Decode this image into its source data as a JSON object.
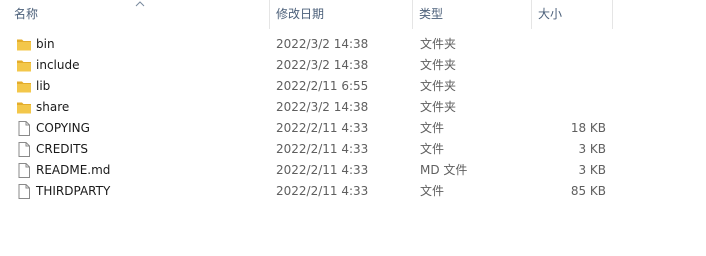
{
  "columns": {
    "name": "名称",
    "date": "修改日期",
    "type": "类型",
    "size": "大小"
  },
  "colors": {
    "folder": "#f3c74a",
    "folder_tab": "#e4ad2b",
    "header_text": "#4c607a"
  },
  "rows": [
    {
      "name": "bin",
      "date": "2022/3/2 14:38",
      "type": "文件夹",
      "size": "",
      "icon": "folder-icon"
    },
    {
      "name": "include",
      "date": "2022/3/2 14:38",
      "type": "文件夹",
      "size": "",
      "icon": "folder-icon"
    },
    {
      "name": "lib",
      "date": "2022/2/11 6:55",
      "type": "文件夹",
      "size": "",
      "icon": "folder-icon"
    },
    {
      "name": "share",
      "date": "2022/3/2 14:38",
      "type": "文件夹",
      "size": "",
      "icon": "folder-icon"
    },
    {
      "name": "COPYING",
      "date": "2022/2/11 4:33",
      "type": "文件",
      "size": "18 KB",
      "icon": "file-icon"
    },
    {
      "name": "CREDITS",
      "date": "2022/2/11 4:33",
      "type": "文件",
      "size": "3 KB",
      "icon": "file-icon"
    },
    {
      "name": "README.md",
      "date": "2022/2/11 4:33",
      "type": "MD 文件",
      "size": "3 KB",
      "icon": "file-icon"
    },
    {
      "name": "THIRDPARTY",
      "date": "2022/2/11 4:33",
      "type": "文件",
      "size": "85 KB",
      "icon": "file-icon"
    }
  ]
}
